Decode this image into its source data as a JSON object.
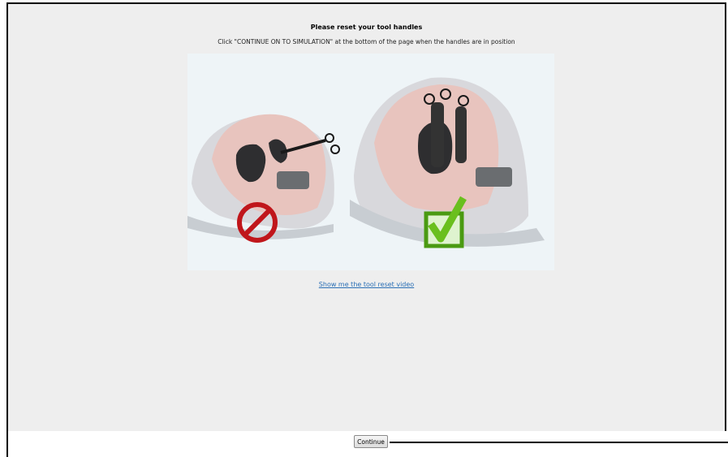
{
  "page": {
    "title": "Please reset your tool handles",
    "instruction": "Click \"CONTINUE ON TO SIMULATION\" at the bottom of the page when the handles are in position",
    "video_link": "Show me the tool reset video"
  },
  "illustration": {
    "incorrect_icon": "prohibited-icon",
    "correct_icon": "checkmark-icon",
    "colors": {
      "prohibited": "#c0161b",
      "check": "#6abf1e",
      "check_box": "#4a9a12"
    }
  },
  "footer": {
    "continue_label": "Continue"
  }
}
